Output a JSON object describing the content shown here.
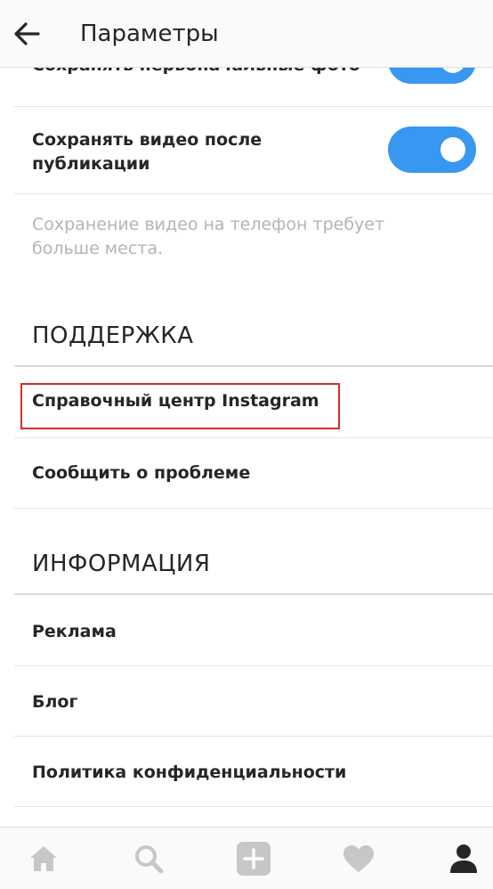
{
  "header": {
    "title": "Параметры",
    "back_icon": "arrow-left-icon"
  },
  "settings": {
    "save_original_photos": {
      "label": "Сохранять первоначальные фото",
      "enabled": true
    },
    "save_videos": {
      "label_line1": "Сохранять видео после",
      "label_line2": "публикации",
      "enabled": true
    },
    "hint_line1": "Сохранение видео на телефон требует",
    "hint_line2": "больше места."
  },
  "support": {
    "title": "ПОДДЕРЖКА",
    "items": [
      {
        "label": "Справочный центр Instagram"
      },
      {
        "label": "Сообщить о проблеме"
      }
    ]
  },
  "info": {
    "title": "ИНФОРМАЦИЯ",
    "items": [
      {
        "label": "Реклама"
      },
      {
        "label": "Блог"
      },
      {
        "label": "Политика конфиденциальности"
      }
    ]
  },
  "bottom_nav": {
    "items": [
      {
        "icon": "home-icon"
      },
      {
        "icon": "search-icon"
      },
      {
        "icon": "add-post-icon"
      },
      {
        "icon": "heart-icon"
      },
      {
        "icon": "profile-icon"
      }
    ]
  },
  "colors": {
    "accent": "#3897f0",
    "highlight": "#d32f2f",
    "text": "#262626",
    "hint": "#b4b4b4"
  }
}
